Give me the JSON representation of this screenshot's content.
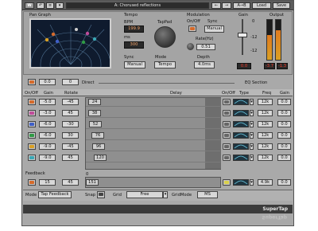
{
  "topbar": {
    "preset": "A: Chorused reflections",
    "compare": "A→B",
    "load": "Load",
    "save": "Save"
  },
  "pan_graph": {
    "title": "Pan Graph"
  },
  "tempo": {
    "title": "Tempo",
    "bpm_label": "BPM",
    "bpm": "199.9",
    "ms_label": "ms",
    "ms": "300",
    "tap_pad": "TapPad",
    "sync_label": "Sync",
    "sync": "Manual",
    "mode_label": "Mode",
    "mode": "Tempo"
  },
  "modulation": {
    "title": "Modulation",
    "onoff_label": "On/Off",
    "sync_label": "Sync",
    "sync": "Manual",
    "rate_label": "Rate(Hz)",
    "rate": "0.51",
    "depth_label": "Depth",
    "depth": "4.0ms"
  },
  "gain": {
    "title": "Gain",
    "scale": [
      "0",
      "-12",
      "-12"
    ],
    "value": "0.0"
  },
  "output": {
    "title": "Output",
    "left": "-3.7",
    "right": "-1.3",
    "levels": [
      0.62,
      0.74
    ]
  },
  "direct": {
    "label": "Direct",
    "gain": "0.0",
    "rotate": "0"
  },
  "taps_header": {
    "onoff": "On/Off",
    "gain": "Gain",
    "rotate": "Rotate",
    "delay": "Delay"
  },
  "taps": [
    {
      "gain": "-5.0",
      "rotate": "-45",
      "delay": "24",
      "color": "#d66a2a"
    },
    {
      "gain": "-3.0",
      "rotate": "45",
      "delay": "38",
      "color": "#c04c9a"
    },
    {
      "gain": "-6.0",
      "rotate": "-30",
      "delay": "52",
      "color": "#3f5fc8"
    },
    {
      "gain": "-6.0",
      "rotate": "30",
      "delay": "76",
      "color": "#2f9a45"
    },
    {
      "gain": "-9.0",
      "rotate": "-45",
      "delay": "96",
      "color": "#d9a024"
    },
    {
      "gain": "-9.0",
      "rotate": "45",
      "delay": "120",
      "color": "#3aa7b5"
    }
  ],
  "eq": {
    "title": "EQ Section",
    "header": {
      "onoff": "On/Off",
      "type": "Type",
      "freq": "Freq",
      "gain": "Gain"
    },
    "rows": [
      {
        "freq": "12k",
        "gain": "0.0"
      },
      {
        "freq": "12k",
        "gain": "0.0"
      },
      {
        "freq": "12k",
        "gain": "0.0"
      },
      {
        "freq": "12k",
        "gain": "0.0"
      },
      {
        "freq": "12k",
        "gain": "0.0"
      },
      {
        "freq": "12k",
        "gain": "0.0"
      }
    ],
    "feedback_row": {
      "freq": "4.9k",
      "gain": "0.0"
    }
  },
  "feedback": {
    "label": "Feedback",
    "gain": "15",
    "rotate": "45",
    "delay": "151",
    "zero": "0"
  },
  "bottom": {
    "mode_label": "Mode",
    "mode": "Tap Feedback",
    "snap_label": "Snap",
    "grid_label": "Grid",
    "grid": "Free",
    "gridmode_label": "GridMode",
    "gridmode": "MS"
  },
  "footer": {
    "plugin": "SuperTap"
  }
}
